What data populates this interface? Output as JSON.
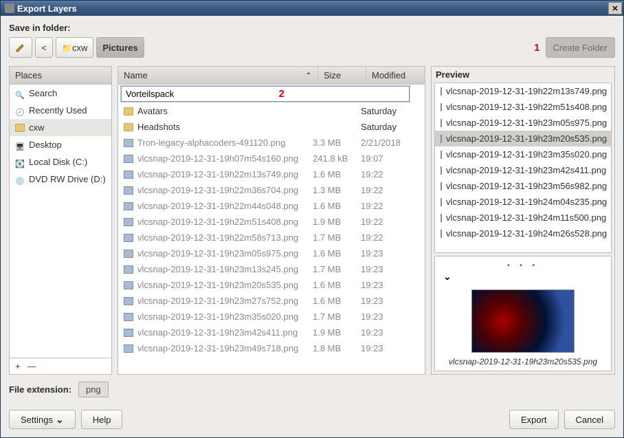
{
  "title": "Export Layers",
  "save_in_folder_label": "Save in folder:",
  "breadcrumb": {
    "back": "<",
    "folder": "cxw",
    "current": "Pictures"
  },
  "annotation": {
    "one": "1",
    "two": "2"
  },
  "create_folder_label": "Create Folder",
  "places": {
    "header": "Places",
    "items": [
      {
        "label": "Search",
        "icon": "i-search"
      },
      {
        "label": "Recently Used",
        "icon": "i-recent"
      },
      {
        "label": "cxw",
        "icon": "i-folder"
      },
      {
        "label": "Desktop",
        "icon": "i-desktop"
      },
      {
        "label": "Local Disk (C:)",
        "icon": "i-disk"
      },
      {
        "label": "DVD RW Drive (D:)",
        "icon": "i-dvd"
      }
    ],
    "add": "+",
    "remove": "—"
  },
  "files": {
    "headers": {
      "name": "Name",
      "size": "Size",
      "modified": "Modified"
    },
    "rename_value": "Vorteilspack",
    "rows": [
      {
        "name": "Avatars",
        "size": "",
        "modified": "Saturday",
        "type": "folder"
      },
      {
        "name": "Headshots",
        "size": "",
        "modified": "Saturday",
        "type": "folder"
      },
      {
        "name": "Tron-legacy-alphacoders-491120.png",
        "size": "3.3 MB",
        "modified": "2/21/2018",
        "type": "img",
        "dim": true
      },
      {
        "name": "vlcsnap-2019-12-31-19h07m54s160.png",
        "size": "241.8 kB",
        "modified": "19:07",
        "type": "img",
        "dim": true
      },
      {
        "name": "vlcsnap-2019-12-31-19h22m13s749.png",
        "size": "1.6 MB",
        "modified": "19:22",
        "type": "img",
        "dim": true
      },
      {
        "name": "vlcsnap-2019-12-31-19h22m36s704.png",
        "size": "1.3 MB",
        "modified": "19:22",
        "type": "img",
        "dim": true
      },
      {
        "name": "vlcsnap-2019-12-31-19h22m44s048.png",
        "size": "1.6 MB",
        "modified": "19:22",
        "type": "img",
        "dim": true
      },
      {
        "name": "vlcsnap-2019-12-31-19h22m51s408.png",
        "size": "1.9 MB",
        "modified": "19:22",
        "type": "img",
        "dim": true
      },
      {
        "name": "vlcsnap-2019-12-31-19h22m58s713.png",
        "size": "1.7 MB",
        "modified": "19:22",
        "type": "img",
        "dim": true
      },
      {
        "name": "vlcsnap-2019-12-31-19h23m05s975.png",
        "size": "1.6 MB",
        "modified": "19:23",
        "type": "img",
        "dim": true
      },
      {
        "name": "vlcsnap-2019-12-31-19h23m13s245.png",
        "size": "1.7 MB",
        "modified": "19:23",
        "type": "img",
        "dim": true
      },
      {
        "name": "vlcsnap-2019-12-31-19h23m20s535.png",
        "size": "1.6 MB",
        "modified": "19:23",
        "type": "img",
        "dim": true
      },
      {
        "name": "vlcsnap-2019-12-31-19h23m27s752.png",
        "size": "1.6 MB",
        "modified": "19:23",
        "type": "img",
        "dim": true
      },
      {
        "name": "vlcsnap-2019-12-31-19h23m35s020.png",
        "size": "1.7 MB",
        "modified": "19:23",
        "type": "img",
        "dim": true
      },
      {
        "name": "vlcsnap-2019-12-31-19h23m42s411.png",
        "size": "1.9 MB",
        "modified": "19:23",
        "type": "img",
        "dim": true
      },
      {
        "name": "vlcsnap-2019-12-31-19h23m49s718.png",
        "size": "1.8 MB",
        "modified": "19:23",
        "type": "img",
        "dim": true
      }
    ]
  },
  "preview": {
    "header": "Preview",
    "items": [
      "vlcsnap-2019-12-31-19h22m13s749.png",
      "vlcsnap-2019-12-31-19h22m51s408.png",
      "vlcsnap-2019-12-31-19h23m05s975.png",
      "vlcsnap-2019-12-31-19h23m20s535.png",
      "vlcsnap-2019-12-31-19h23m35s020.png",
      "vlcsnap-2019-12-31-19h23m42s411.png",
      "vlcsnap-2019-12-31-19h23m56s982.png",
      "vlcsnap-2019-12-31-19h24m04s235.png",
      "vlcsnap-2019-12-31-19h24m11s500.png",
      "vlcsnap-2019-12-31-19h24m26s528.png"
    ],
    "selected_index": 3,
    "caption": "vlcsnap-2019-12-31-19h23m20s535.png"
  },
  "file_extension": {
    "label": "File extension:",
    "value": "png"
  },
  "buttons": {
    "settings": "Settings",
    "help": "Help",
    "export": "Export",
    "cancel": "Cancel"
  }
}
